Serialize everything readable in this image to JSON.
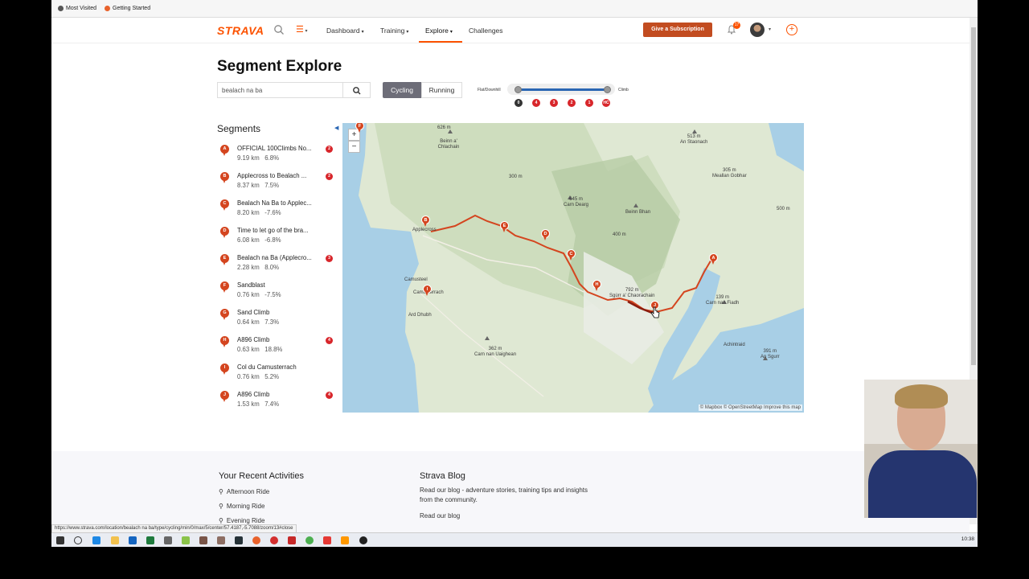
{
  "browser": {
    "bookmarks": [
      "Most Visited",
      "Getting Started"
    ],
    "status_url": "https://www.strava.com/location/bealach na ba/type/cycling/min/0/max/5/center/57.4187,-5.7088/zoom/13#close",
    "clock": "10:38"
  },
  "nav": {
    "logo": "STRAVA",
    "links": [
      "Dashboard",
      "Training",
      "Explore",
      "Challenges"
    ],
    "active_link": "Explore",
    "subscription_button": "Give a Subscription",
    "notification_count": "17"
  },
  "page": {
    "title": "Segment Explore",
    "search_value": "bealach na ba",
    "activity_toggle": [
      "Cycling",
      "Running"
    ],
    "activity_selected": "Cycling",
    "slider": {
      "left_label": "Flat/Downhill",
      "right_label": "Climb",
      "categories": [
        "0",
        "4",
        "3",
        "2",
        "1",
        "HC"
      ],
      "min_index": 0,
      "max_index": 5
    }
  },
  "segments": {
    "heading": "Segments",
    "items": [
      {
        "letter": "A",
        "name": "OFFICIAL 100Climbs No...",
        "distance": "9.19 km",
        "grade": "6.8%",
        "cat": "2"
      },
      {
        "letter": "B",
        "name": "Applecross to Bealach ...",
        "distance": "8.37 km",
        "grade": "7.5%",
        "cat": "2"
      },
      {
        "letter": "C",
        "name": "Bealach Na Ba to Applec...",
        "distance": "8.20 km",
        "grade": "-7.6%",
        "cat": ""
      },
      {
        "letter": "D",
        "name": "Time to let go of the bra...",
        "distance": "6.08 km",
        "grade": "-6.8%",
        "cat": ""
      },
      {
        "letter": "E",
        "name": "Bealach na Ba (Applecro...",
        "distance": "2.28 km",
        "grade": "8.0%",
        "cat": "3"
      },
      {
        "letter": "F",
        "name": "Sandblast",
        "distance": "0.76 km",
        "grade": "-7.5%",
        "cat": ""
      },
      {
        "letter": "G",
        "name": "Sand Climb",
        "distance": "0.64 km",
        "grade": "7.3%",
        "cat": ""
      },
      {
        "letter": "H",
        "name": "A896 Climb",
        "distance": "0.63 km",
        "grade": "18.8%",
        "cat": "4"
      },
      {
        "letter": "I",
        "name": "Col du Camusterrach",
        "distance": "0.76 km",
        "grade": "5.2%",
        "cat": ""
      },
      {
        "letter": "J",
        "name": "A896 Climb",
        "distance": "1.53 km",
        "grade": "7.4%",
        "cat": "4"
      }
    ]
  },
  "map": {
    "zoom_in": "+",
    "zoom_out": "−",
    "attribution": "© Mapbox © OpenStreetMap Improve this map",
    "labels": [
      {
        "id": "l1",
        "text": "626 m"
      },
      {
        "id": "l2",
        "text": "Beinn a' Chlachain"
      },
      {
        "id": "l3",
        "text": "513 m\nAn Staonach"
      },
      {
        "id": "l4",
        "text": "305 m\nMeallan Gobhar"
      },
      {
        "id": "l5",
        "text": "645 m\nCarn Dearg"
      },
      {
        "id": "l6",
        "text": "Beinn Bhan"
      },
      {
        "id": "l7",
        "text": "Applecross"
      },
      {
        "id": "l8",
        "text": "Camusteel"
      },
      {
        "id": "l9",
        "text": "Camusterrach"
      },
      {
        "id": "l10",
        "text": "Ard Dhubh"
      },
      {
        "id": "l11",
        "text": "792 m\nSgùrr a' Chaorachain"
      },
      {
        "id": "l12",
        "text": "139 m\nCarn nan Fiadh"
      },
      {
        "id": "l13",
        "text": "Achintraid"
      },
      {
        "id": "l14",
        "text": "362 m\nCarn nan Uaighean"
      },
      {
        "id": "l15",
        "text": "391 m\nAn Sgurr"
      },
      {
        "id": "l16",
        "text": "300 m"
      },
      {
        "id": "l17",
        "text": "400 m"
      },
      {
        "id": "l18",
        "text": "500 m"
      }
    ],
    "pins": [
      "F",
      "B",
      "E",
      "D",
      "C",
      "A",
      "H",
      "I",
      "J"
    ]
  },
  "footer": {
    "recent_heading": "Your Recent Activities",
    "recent_items": [
      "Afternoon Ride",
      "Morning Ride",
      "Evening Ride"
    ],
    "blog_heading": "Strava Blog",
    "blog_text": "Read our blog - adventure stories, training tips and insights from the community.",
    "blog_link": "Read our blog"
  },
  "colors": {
    "brand": "#fc5200",
    "pin": "#d4451f",
    "route": "#d4451f",
    "water": "#a8cfe6"
  }
}
